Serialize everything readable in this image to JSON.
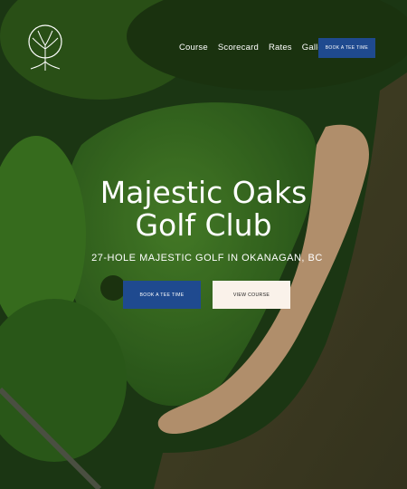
{
  "brand": {
    "logo_icon": "oak-tree-icon"
  },
  "nav": {
    "items": [
      "Course",
      "Scorecard",
      "Rates",
      "Gallery"
    ],
    "cta_label": "BOOK A TEE TIME"
  },
  "hero": {
    "title_line1": "Majestic Oaks",
    "title_line2": "Golf Club",
    "subtitle": "27-HOLE MAJESTIC GOLF IN OKANAGAN, BC",
    "primary_button": "BOOK A TEE TIME",
    "secondary_button": "VIEW COURSE"
  },
  "colors": {
    "accent": "#1f4a8f",
    "button_light": "#faf2ea",
    "text": "#ffffff"
  }
}
